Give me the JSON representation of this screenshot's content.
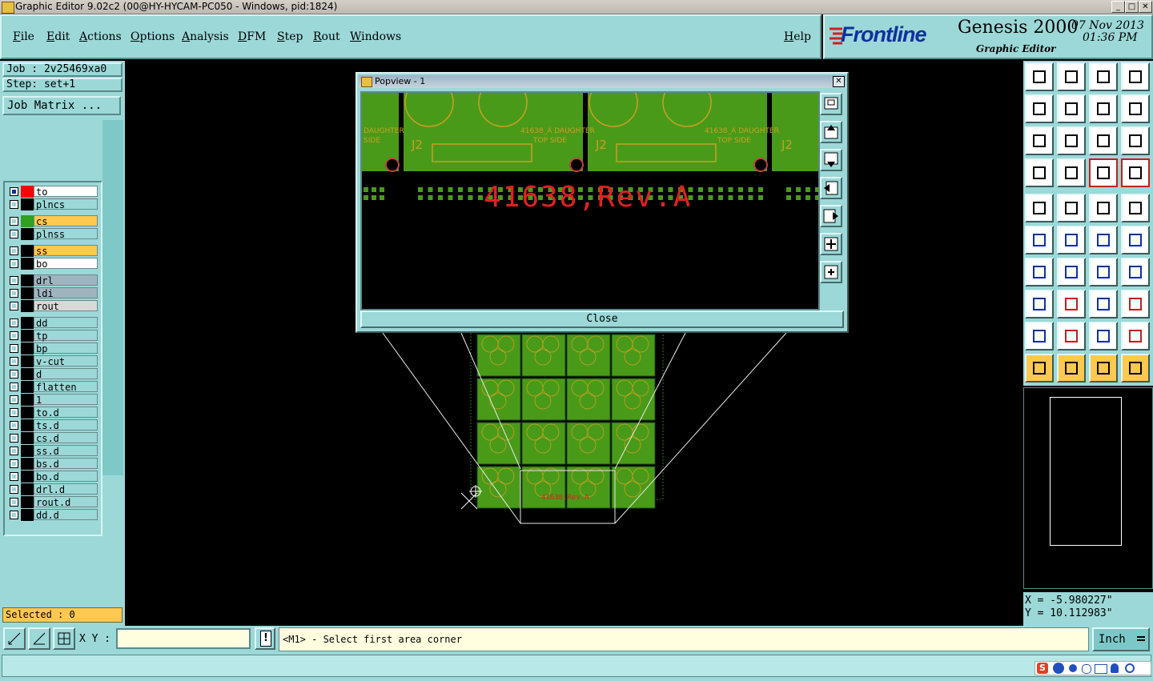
{
  "window": {
    "title": "Graphic Editor 9.02c2 (00@HY-HYCAM-PC050 - Windows, pid:1824)"
  },
  "menu": {
    "items": [
      "File",
      "Edit",
      "Actions",
      "Options",
      "Analysis",
      "DFM",
      "Step",
      "Rout",
      "Windows"
    ],
    "help": "Help"
  },
  "brand": {
    "logo": "Frontline",
    "product": "Genesis 2000",
    "date": "07 Nov 2013",
    "time": "01:36 PM",
    "subtitle": "Graphic Editor"
  },
  "job": {
    "job_label": "Job : 2v25469xa0",
    "step_label": "Step: set+1",
    "matrix_button": "Job Matrix ..."
  },
  "layers": [
    {
      "name": "to",
      "bg": "#ffffff",
      "color": "#ff0000",
      "work": true
    },
    {
      "name": "plncs",
      "bg": "#9cd8d8",
      "color": "#000000"
    },
    {
      "name": "cs",
      "bg": "#ffc850",
      "color": "#30a020"
    },
    {
      "name": "plnss",
      "bg": "#9cd8d8",
      "color": "#000000"
    },
    {
      "name": "ss",
      "bg": "#ffc850",
      "color": "#000000"
    },
    {
      "name": "bo",
      "bg": "#ffffff",
      "color": "#000000"
    },
    {
      "name": "drl",
      "bg": "#a0b4c0",
      "color": "#000000"
    },
    {
      "name": "ldi",
      "bg": "#a0b4c0",
      "color": "#000000"
    },
    {
      "name": "rout",
      "bg": "#d8d8d8",
      "color": "#000000"
    },
    {
      "name": "dd",
      "bg": "#9cd8d8",
      "color": "#000000"
    },
    {
      "name": "tp",
      "bg": "#9cd8d8",
      "color": "#000000"
    },
    {
      "name": "bp",
      "bg": "#9cd8d8",
      "color": "#000000"
    },
    {
      "name": "v-cut",
      "bg": "#9cd8d8",
      "color": "#000000"
    },
    {
      "name": "d",
      "bg": "#9cd8d8",
      "color": "#000000"
    },
    {
      "name": "flatten",
      "bg": "#9cd8d8",
      "color": "#000000"
    },
    {
      "name": "1",
      "bg": "#9cd8d8",
      "color": "#000000"
    },
    {
      "name": "to.d",
      "bg": "#9cd8d8",
      "color": "#000000"
    },
    {
      "name": "ts.d",
      "bg": "#9cd8d8",
      "color": "#000000"
    },
    {
      "name": "cs.d",
      "bg": "#9cd8d8",
      "color": "#000000"
    },
    {
      "name": "ss.d",
      "bg": "#9cd8d8",
      "color": "#000000"
    },
    {
      "name": "bs.d",
      "bg": "#9cd8d8",
      "color": "#000000"
    },
    {
      "name": "bo.d",
      "bg": "#9cd8d8",
      "color": "#000000"
    },
    {
      "name": "drl.d",
      "bg": "#9cd8d8",
      "color": "#000000"
    },
    {
      "name": "rout.d",
      "bg": "#9cd8d8",
      "color": "#000000"
    },
    {
      "name": "dd.d",
      "bg": "#9cd8d8",
      "color": "#000000"
    }
  ],
  "selected": "Selected : 0",
  "popview": {
    "title": "Popview - 1",
    "close_label": "Close",
    "board_labels": [
      "DAUGHTER",
      "SIDE",
      "J2",
      "41638_A DAUGHTER",
      "TOP SIDE",
      "J2",
      "41638_A DAUGHTER",
      "TOP SIDE",
      "J2"
    ],
    "rev_text": "41638,Rev.A"
  },
  "canvas": {
    "rev_text": "41638,Rev.A"
  },
  "coords": {
    "x": "X = -5.980227\"",
    "y": "Y = 10.112983\""
  },
  "bottom": {
    "xy_label": "X Y :",
    "xy_value": "",
    "prompt": "<M1> - Select first area corner",
    "units": "Inch"
  },
  "colors": {
    "panel": "#9cd8d8",
    "board": "#4a9a1a",
    "copper": "#c8a020",
    "rev": "#e02020"
  }
}
